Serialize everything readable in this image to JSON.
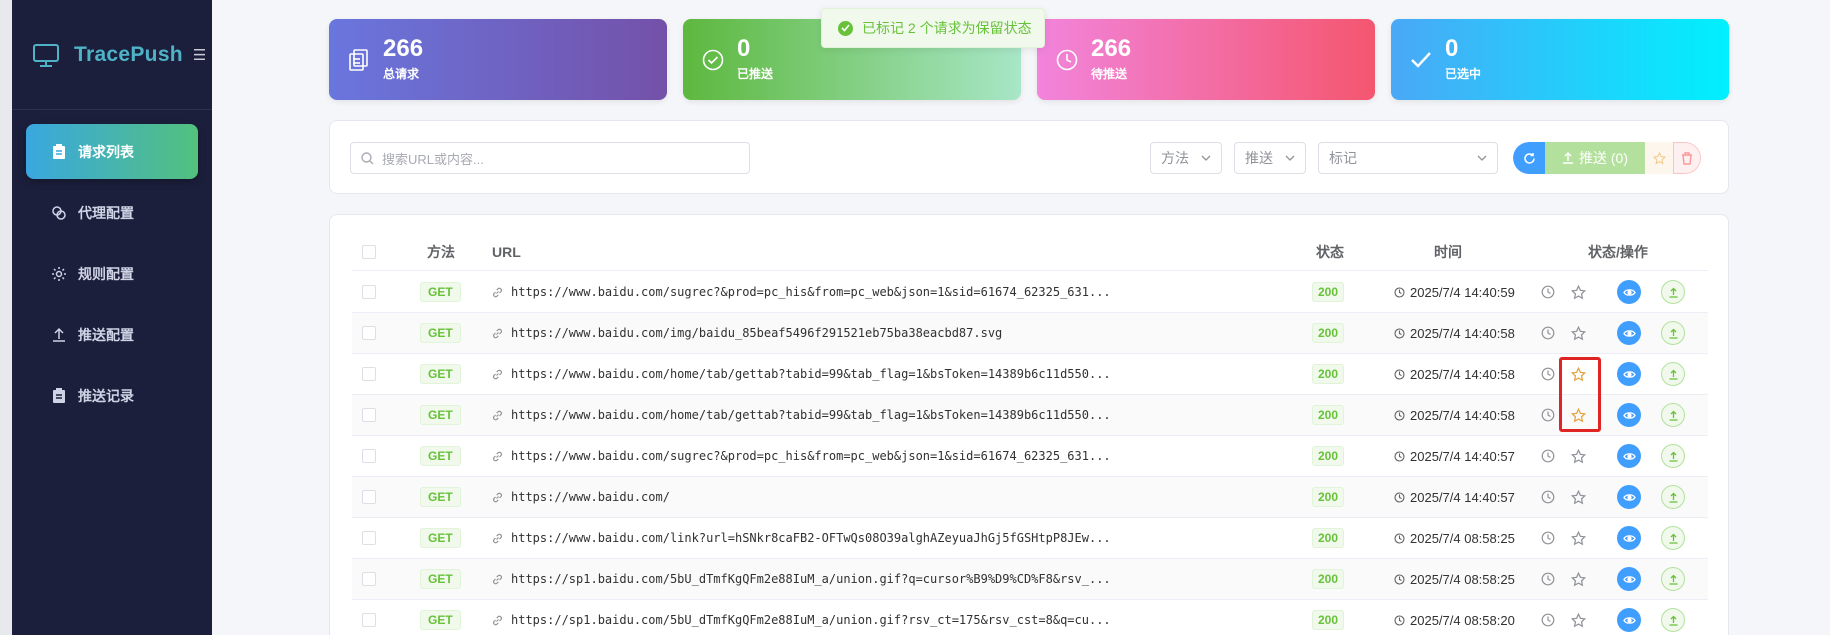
{
  "app": {
    "name": "TracePush"
  },
  "sidebar": {
    "items": [
      {
        "label": "请求列表",
        "icon": "clipboard-icon",
        "active": true
      },
      {
        "label": "代理配置",
        "icon": "link-icon",
        "active": false
      },
      {
        "label": "规则配置",
        "icon": "gear-icon",
        "active": false
      },
      {
        "label": "推送配置",
        "icon": "upload-icon",
        "active": false
      },
      {
        "label": "推送记录",
        "icon": "clipboard-icon",
        "active": false
      }
    ]
  },
  "stats": [
    {
      "value": "266",
      "label": "总请求",
      "icon": "copy-icon"
    },
    {
      "value": "0",
      "label": "已推送",
      "icon": "check-circle-icon"
    },
    {
      "value": "266",
      "label": "待推送",
      "icon": "clock-icon"
    },
    {
      "value": "0",
      "label": "已选中",
      "icon": "check-icon"
    }
  ],
  "toast": {
    "text": "已标记 2 个请求为保留状态"
  },
  "filters": {
    "search_placeholder": "搜索URL或内容...",
    "method": "方法",
    "push": "推送",
    "mark": "标记",
    "push_button": "推送 (0)"
  },
  "table": {
    "headers": {
      "method": "方法",
      "url": "URL",
      "status": "状态",
      "time": "时间",
      "ops": "状态/操作"
    },
    "rows": [
      {
        "method": "GET",
        "url": "https://www.baidu.com/sugrec?&prod=pc_his&from=pc_web&json=1&sid=61674_62325_631...",
        "status": "200",
        "time": "2025/7/4 14:40:59",
        "starred": false
      },
      {
        "method": "GET",
        "url": "https://www.baidu.com/img/baidu_85beaf5496f291521eb75ba38eacbd87.svg",
        "status": "200",
        "time": "2025/7/4 14:40:58",
        "starred": false
      },
      {
        "method": "GET",
        "url": "https://www.baidu.com/home/tab/gettab?tabid=99&tab_flag=1&bsToken=14389b6c11d550...",
        "status": "200",
        "time": "2025/7/4 14:40:58",
        "starred": true
      },
      {
        "method": "GET",
        "url": "https://www.baidu.com/home/tab/gettab?tabid=99&tab_flag=1&bsToken=14389b6c11d550...",
        "status": "200",
        "time": "2025/7/4 14:40:58",
        "starred": true
      },
      {
        "method": "GET",
        "url": "https://www.baidu.com/sugrec?&prod=pc_his&from=pc_web&json=1&sid=61674_62325_631...",
        "status": "200",
        "time": "2025/7/4 14:40:57",
        "starred": false
      },
      {
        "method": "GET",
        "url": "https://www.baidu.com/",
        "status": "200",
        "time": "2025/7/4 14:40:57",
        "starred": false
      },
      {
        "method": "GET",
        "url": "https://www.baidu.com/link?url=hSNkr8caFB2-OFTwQs08O39alghAZeyuaJhGj5fGSHtpP8JEw...",
        "status": "200",
        "time": "2025/7/4 08:58:25",
        "starred": false
      },
      {
        "method": "GET",
        "url": "https://sp1.baidu.com/5bU_dTmfKgQFm2e88IuM_a/union.gif?q=cursor%B9%D9%CD%F8&rsv_...",
        "status": "200",
        "time": "2025/7/4 08:58:25",
        "starred": false
      },
      {
        "method": "GET",
        "url": "https://sp1.baidu.com/5bU_dTmfKgQFm2e88IuM_a/union.gif?rsv_ct=175&rsv_cst=8&q=cu...",
        "status": "200",
        "time": "2025/7/4 08:58:20",
        "starred": false
      }
    ]
  },
  "colors": {
    "accent": "#409eff",
    "success": "#67c23a",
    "star": "#e6a23c",
    "highlight": "#e02424"
  }
}
